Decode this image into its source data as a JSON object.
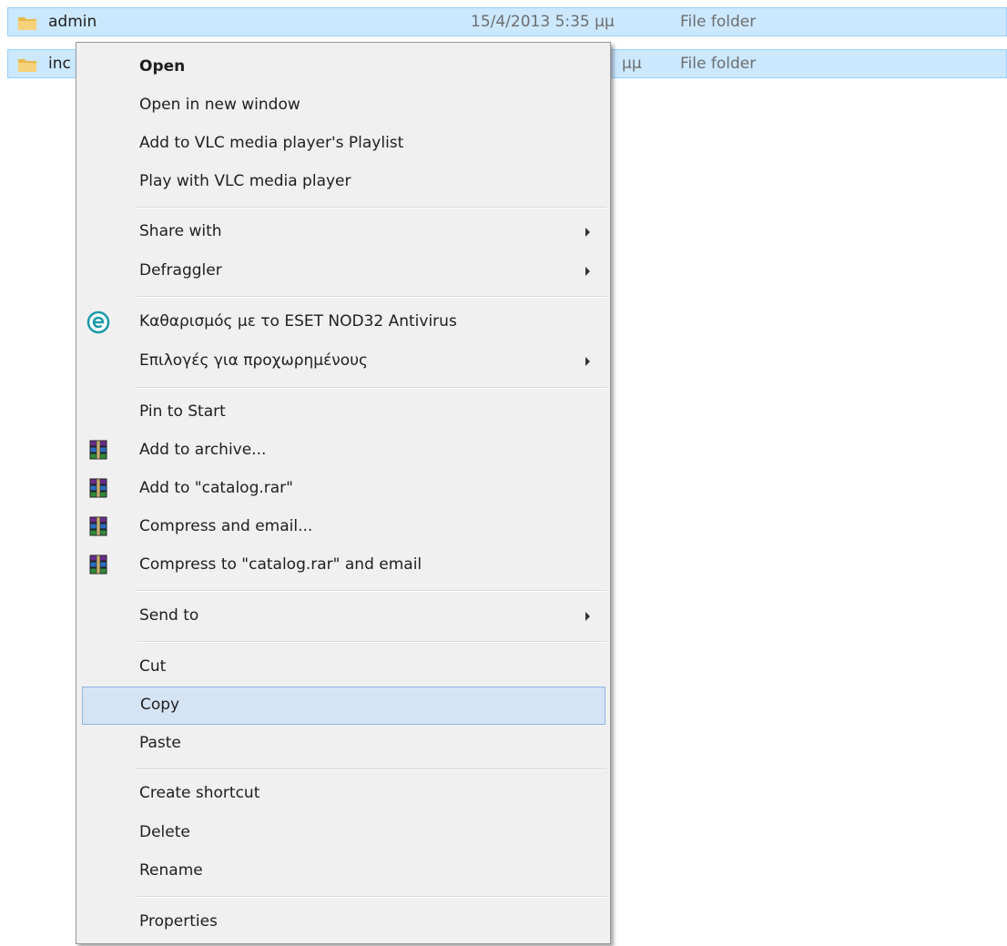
{
  "files": [
    {
      "name": "admin",
      "date": "15/4/2013 5:35 μμ",
      "type": "File folder",
      "icon": "folder-icon"
    },
    {
      "name": "inc",
      "date": "μμ",
      "type": "File folder",
      "icon": "folder-icon"
    }
  ],
  "menu": {
    "open": "Open",
    "open_new_window": "Open in new window",
    "vlc_add_playlist": "Add to VLC media player's Playlist",
    "vlc_play": "Play with VLC media player",
    "share_with": "Share with",
    "defraggler": "Defraggler",
    "eset_clean": "Καθαρισμός με το ESET NOD32 Antivirus",
    "eset_advanced": "Επιλογές για προχωρημένους",
    "pin_to_start": "Pin to Start",
    "add_to_archive": "Add to archive...",
    "add_to_rar": "Add to \"catalog.rar\"",
    "compress_email": "Compress and email...",
    "compress_rar_email": "Compress to \"catalog.rar\" and email",
    "send_to": "Send to",
    "cut": "Cut",
    "copy": "Copy",
    "paste": "Paste",
    "create_shortcut": "Create shortcut",
    "delete": "Delete",
    "rename": "Rename",
    "properties": "Properties"
  },
  "icons": {
    "eset": "eset-icon",
    "winrar": "winrar-icon",
    "submenu": "submenu-arrow-icon"
  },
  "colors": {
    "selection_bg": "#cce8ff",
    "menu_bg": "#f0f0f0",
    "menu_hover": "#d5e4f5",
    "eset_teal": "#1a9aa6"
  }
}
